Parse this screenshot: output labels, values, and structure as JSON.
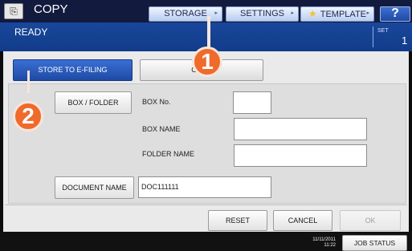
{
  "header": {
    "app_title": "COPY",
    "status": "READY",
    "set_label": "SET",
    "set_value": "1",
    "buttons": {
      "storage": "STORAGE",
      "settings": "SETTINGS",
      "template": "TEMPLATE",
      "help": "?"
    }
  },
  "tabs": {
    "store": "STORE TO E-FILING",
    "copy": "COPY"
  },
  "form": {
    "box_folder_label": "BOX / FOLDER",
    "box_no_label": "BOX No.",
    "box_name_label": "BOX NAME",
    "folder_name_label": "FOLDER NAME",
    "document_name_label": "DOCUMENT NAME",
    "document_name_value": "DOC111111",
    "box_no_value": "",
    "box_name_value": "",
    "folder_name_value": ""
  },
  "actions": {
    "reset": "RESET",
    "cancel": "CANCEL",
    "ok": "OK"
  },
  "bottom": {
    "date": "11/11/2011",
    "time": "11:22",
    "job_status": "JOB STATUS"
  },
  "callouts": {
    "one": "1",
    "two": "2"
  },
  "colors": {
    "header_blue": "#1e4fa7",
    "callout_orange": "#ef6a2b",
    "background": "#eaeaea"
  },
  "icons": {
    "app": "copy-icon",
    "template": "star-icon"
  }
}
